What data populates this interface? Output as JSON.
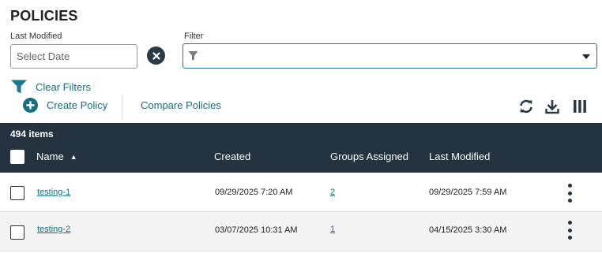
{
  "page": {
    "title": "POLICIES"
  },
  "filters": {
    "last_modified_label": "Last Modified",
    "date_placeholder": "Select Date",
    "filter_label": "Filter",
    "filter_value": "",
    "clear_filters": "Clear Filters"
  },
  "toolbar": {
    "create_label": "Create Policy",
    "compare_label": "Compare Policies",
    "icons": [
      "refresh-icon",
      "download-icon",
      "columns-icon"
    ]
  },
  "table": {
    "count": "494 items",
    "columns": {
      "name": "Name",
      "created": "Created",
      "groups": "Groups Assigned",
      "modified": "Last Modified"
    },
    "sort_indicator": "▲",
    "rows": [
      {
        "name": "testing-1",
        "created": "09/29/2025 7:20 AM",
        "groups": "2",
        "modified": "09/29/2025 7:59 AM"
      },
      {
        "name": "testing-2",
        "created": "03/07/2025 10:31 AM",
        "groups": "1",
        "modified": "04/15/2025 3:30 AM"
      }
    ]
  },
  "colors": {
    "header_bg": "#253341",
    "accent": "#1a6e80",
    "dark_icon": "#2b3a47"
  }
}
